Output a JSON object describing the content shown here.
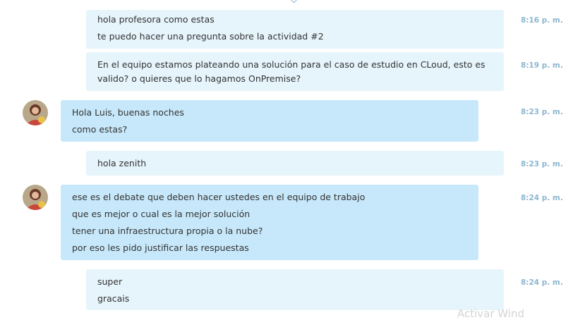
{
  "messages": [
    {
      "lines": [
        "hola profesora como estas",
        "te puedo hacer una pregunta sobre la actividad #2"
      ],
      "time": "8:16 p. m."
    },
    {
      "lines": [
        "En el equipo estamos plateando una solución para el caso de estudio en CLoud, esto es",
        "valido? o quieres que lo hagamos OnPremise?"
      ],
      "time": "8:19 p. m."
    },
    {
      "lines": [
        "Hola Luis, buenas noches",
        "como estas?"
      ],
      "time": "8:23 p. m."
    },
    {
      "lines": [
        "hola zenith"
      ],
      "time": "8:23 p. m."
    },
    {
      "lines": [
        "ese es el debate que deben hacer ustedes en el equipo de trabajo",
        "que es mejor o cual es la mejor solución",
        "tener una infraestructura propia o la nube?",
        "por eso les pido justificar las respuestas"
      ],
      "time": "8:24 p. m."
    },
    {
      "lines": [
        "super",
        "gracais"
      ],
      "time": "8:24 p. m."
    }
  ],
  "watermark": "Activar Wind",
  "colors": {
    "sent_bubble": "#e6f4fc",
    "received_bubble": "#c7e8fa",
    "timestamp": "#8cb6d0"
  }
}
